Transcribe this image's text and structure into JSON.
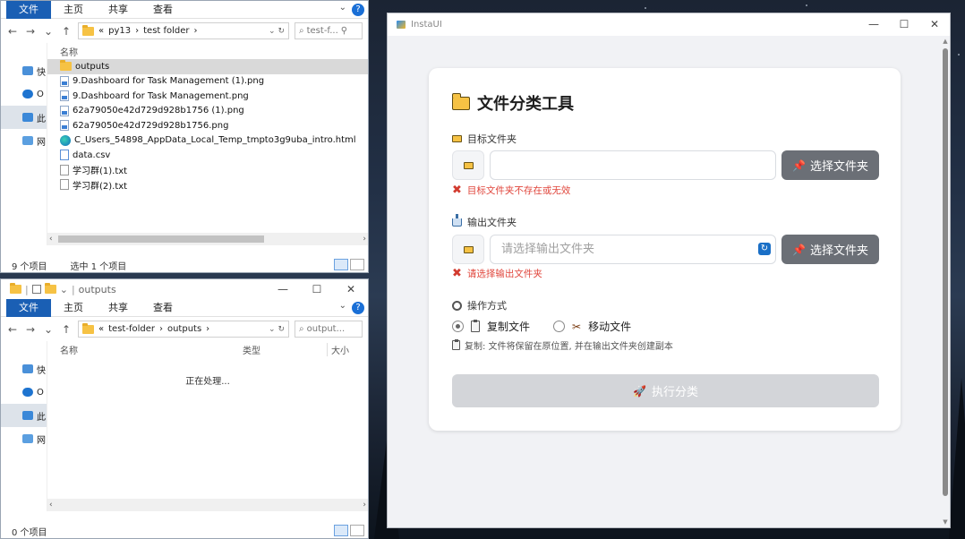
{
  "explorer_top": {
    "ribbon": [
      "文件",
      "主页",
      "共享",
      "查看"
    ],
    "address": [
      "py13",
      "test folder"
    ],
    "search_placeholder": "test-f...",
    "column_name": "名称",
    "sidebar": [
      "快",
      "O",
      "此",
      "网"
    ],
    "files": [
      {
        "name": "outputs",
        "type": "folder"
      },
      {
        "name": "9.Dashboard for Task Management (1).png",
        "type": "img"
      },
      {
        "name": "9.Dashboard for Task Management.png",
        "type": "img"
      },
      {
        "name": "62a79050e42d729d928b1756 (1).png",
        "type": "img"
      },
      {
        "name": "62a79050e42d729d928b1756.png",
        "type": "img"
      },
      {
        "name": "C_Users_54898_AppData_Local_Temp_tmpto3g9uba_intro.html",
        "type": "edge"
      },
      {
        "name": "data.csv",
        "type": "csv"
      },
      {
        "name": "学习群(1).txt",
        "type": "txt"
      },
      {
        "name": "学习群(2).txt",
        "type": "txt"
      }
    ],
    "status_count": "9 个项目",
    "status_selected": "选中 1 个项目"
  },
  "explorer_bottom": {
    "title": "outputs",
    "ribbon": [
      "文件",
      "主页",
      "共享",
      "查看"
    ],
    "address": [
      "test-folder",
      "outputs"
    ],
    "search_placeholder": "output...",
    "columns": [
      "名称",
      "类型",
      "大小"
    ],
    "sidebar": [
      "快",
      "O",
      "此",
      "网"
    ],
    "processing": "正在处理...",
    "status_count": "0 个项目"
  },
  "app": {
    "window_title": "InstaUI",
    "title": "文件分类工具",
    "target_label": "目标文件夹",
    "target_value": "",
    "target_error": "目标文件夹不存在或无效",
    "output_label": "输出文件夹",
    "output_placeholder": "请选择输出文件夹",
    "output_error": "请选择输出文件夹",
    "pick_button": "选择文件夹",
    "mode_label": "操作方式",
    "mode_copy": "复制文件",
    "mode_move": "移动文件",
    "mode_selected": "copy",
    "hint": "复制: 文件将保留在原位置, 并在输出文件夹创建副本",
    "run_button": "执行分类",
    "colors": {
      "error": "#e0463c",
      "pick_button": "#6b6f76",
      "run_disabled": "#d3d5d9"
    }
  }
}
